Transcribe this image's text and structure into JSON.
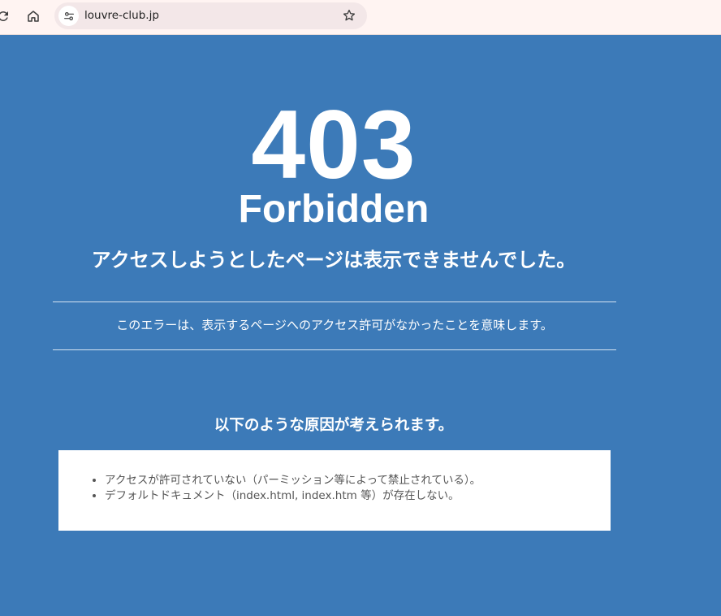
{
  "browser": {
    "url": "louvre-club.jp",
    "icons": {
      "reload": "reload-icon",
      "home": "home-icon",
      "site_info": "site-settings-icon",
      "bookmark": "star-icon"
    }
  },
  "page": {
    "code": "403",
    "status": "Forbidden",
    "message": "アクセスしようとしたページは表示できませんでした。",
    "explanation": "このエラーは、表示するページへのアクセス許可がなかったことを意味します。",
    "causes_title": "以下のような原因が考えられます。",
    "causes": [
      "アクセスが許可されていない（パーミッション等によって禁止されている）。",
      "デフォルトドキュメント（index.html, index.htm 等）が存在しない。"
    ]
  },
  "colors": {
    "background": "#3c7ab8",
    "toolbar": "#fff4f2",
    "omnibox": "#f3e7e8",
    "text": "#ffffff",
    "list_text": "#555555"
  }
}
